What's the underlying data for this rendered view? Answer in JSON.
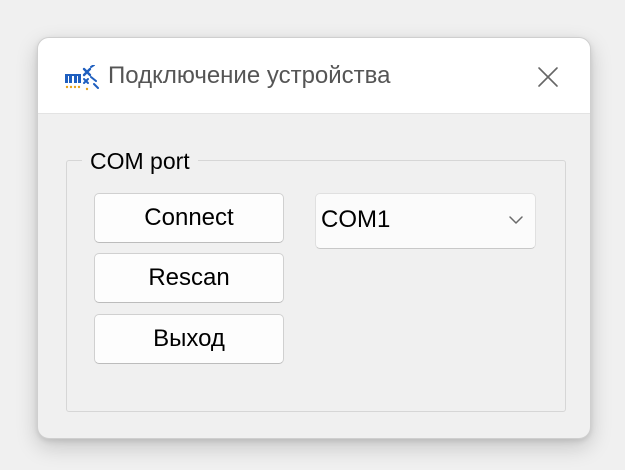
{
  "window": {
    "title": "Подключение устройства",
    "app_icon": "device-app-icon",
    "close_icon": "close-icon"
  },
  "com_port": {
    "group_title": "COM port",
    "buttons": {
      "connect": "Connect",
      "rescan": "Rescan",
      "exit": "Выход"
    },
    "port_select": {
      "selected": "COM1",
      "arrow_icon": "chevron-down-icon"
    }
  },
  "colors": {
    "icon_blue": "#1f5fbf",
    "icon_orange": "#e8a317",
    "titlebar_bg": "#ffffff",
    "body_bg": "#f0f0f0"
  }
}
